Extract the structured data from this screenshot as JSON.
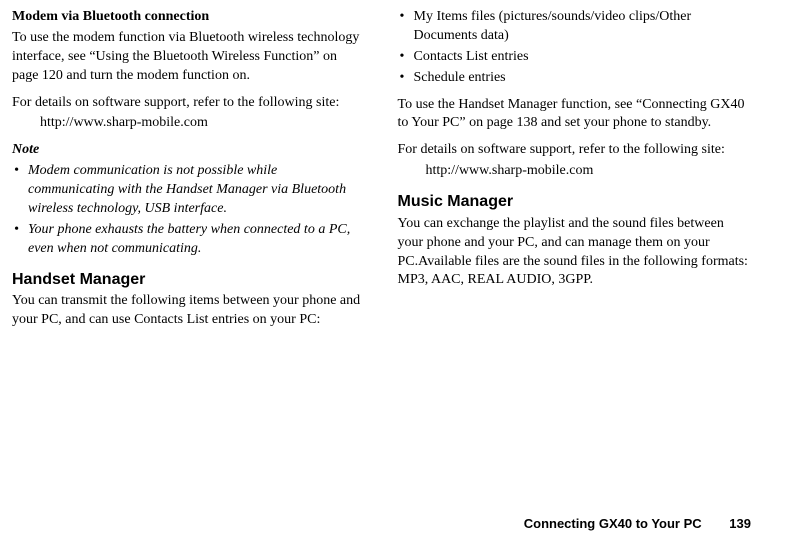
{
  "left": {
    "s1_heading": "Modem via Bluetooth connection",
    "s1_p1": "To use the modem function via Bluetooth wireless technology interface, see “Using the Bluetooth Wireless Function” on page 120 and turn the modem function on.",
    "s1_p2": "For details on software support, refer to the following site:",
    "s1_url": "http://www.sharp-mobile.com",
    "note_label": "Note",
    "note_items": [
      "Modem communication is not possible while communicating with the Handset Manager via Bluetooth wireless technology, USB interface.",
      "Your phone exhausts the battery when connected to a PC, even when not communicating."
    ],
    "s2_heading": "Handset Manager",
    "s2_p1": "You can transmit the following items between your phone and your PC, and can use Contacts List entries on your PC:"
  },
  "right": {
    "items": [
      "My Items files (pictures/sounds/video clips/Other Documents data)",
      "Contacts List entries",
      "Schedule entries"
    ],
    "p1": "To use the Handset Manager function, see “Connecting GX40 to Your PC” on page 138 and set your phone to standby.",
    "p2": "For details on software support, refer to the following site:",
    "url": "http://www.sharp-mobile.com",
    "s3_heading": "Music Manager",
    "s3_p1": "You can exchange the playlist and the sound files between your phone and your PC, and can manage them on your PC.Available files are the sound files in the following formats: MP3, AAC, REAL AUDIO, 3GPP."
  },
  "footer": {
    "title": "Connecting GX40 to Your PC",
    "page": "139"
  }
}
